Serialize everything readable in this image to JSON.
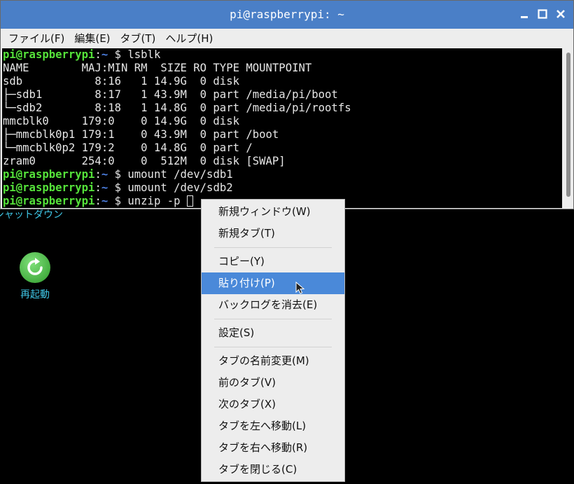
{
  "window": {
    "title": "pi@raspberrypi: ~",
    "controls": [
      "minimize-icon",
      "maximize-icon",
      "close-icon"
    ]
  },
  "menubar": {
    "items": [
      "ファイル(F)",
      "編集(E)",
      "タブ(T)",
      "ヘルプ(H)"
    ]
  },
  "terminal": {
    "prompt_user": "pi@raspberrypi",
    "prompt_sep": ":",
    "prompt_path": "~",
    "prompt_dollar": " $ ",
    "lines": [
      {
        "type": "cmd",
        "text": "lsblk"
      },
      {
        "type": "out",
        "text": "NAME        MAJ:MIN RM  SIZE RO TYPE MOUNTPOINT"
      },
      {
        "type": "out",
        "text": "sdb           8:16   1 14.9G  0 disk "
      },
      {
        "type": "out",
        "text": "├─sdb1        8:17   1 43.9M  0 part /media/pi/boot"
      },
      {
        "type": "out",
        "text": "└─sdb2        8:18   1 14.8G  0 part /media/pi/rootfs"
      },
      {
        "type": "out",
        "text": "mmcblk0     179:0    0 14.9G  0 disk "
      },
      {
        "type": "out",
        "text": "├─mmcblk0p1 179:1    0 43.9M  0 part /boot"
      },
      {
        "type": "out",
        "text": "└─mmcblk0p2 179:2    0 14.8G  0 part /"
      },
      {
        "type": "out",
        "text": "zram0       254:0    0  512M  0 disk [SWAP]"
      },
      {
        "type": "cmd",
        "text": "umount /dev/sdb1"
      },
      {
        "type": "cmd",
        "text": "umount /dev/sdb2"
      },
      {
        "type": "cmd",
        "text": "unzip -p ",
        "cursor": true
      }
    ]
  },
  "desktop": {
    "partial_label": "シャットダウン",
    "icon_label": "再起動",
    "icon_name": "restart-icon",
    "icon_color": "#3fa836"
  },
  "context_menu": {
    "groups": [
      [
        {
          "label": "新規ウィンドウ(W)"
        },
        {
          "label": "新規タブ(T)"
        }
      ],
      [
        {
          "label": "コピー(Y)"
        },
        {
          "label": "貼り付け(P)",
          "active": true
        },
        {
          "label": "バックログを消去(E)"
        }
      ],
      [
        {
          "label": "設定(S)"
        }
      ],
      [
        {
          "label": "タブの名前変更(M)"
        },
        {
          "label": "前のタブ(V)"
        },
        {
          "label": "次のタブ(X)"
        },
        {
          "label": "タブを左へ移動(L)"
        },
        {
          "label": "タブを右へ移動(R)"
        },
        {
          "label": "タブを閉じる(C)"
        }
      ]
    ]
  },
  "colors": {
    "titlebar": "#4a7fc7",
    "prompt_user": "#55e23a",
    "prompt_path": "#4c7fe0",
    "menu_highlight": "#4a89d9",
    "desktop_text": "#3fc6e6"
  }
}
